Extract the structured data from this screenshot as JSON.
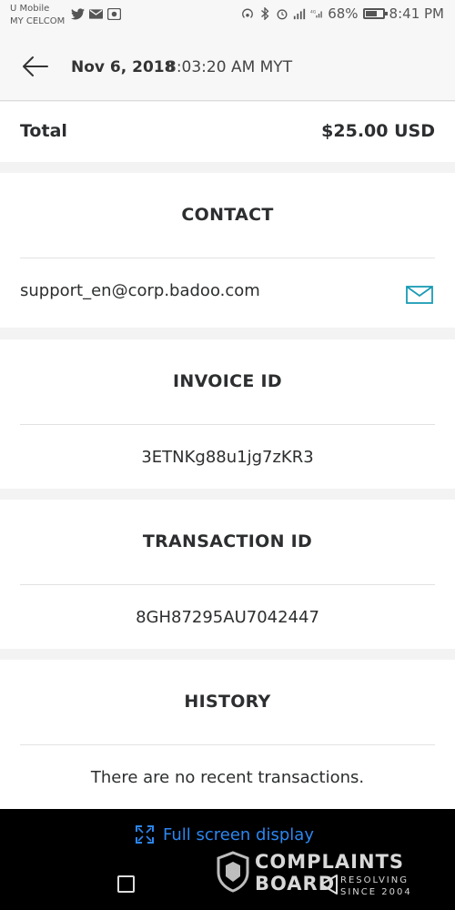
{
  "status_bar": {
    "carrier_line1": "U Mobile",
    "carrier_line2": "MY CELCOM",
    "left_icons": [
      "twitter-icon",
      "mail-icon",
      "image-icon"
    ],
    "right_icons": [
      "hotspot-icon",
      "bluetooth-icon",
      "alarm-icon",
      "signal-icon",
      "4g-icon"
    ],
    "battery_percent": "68%",
    "battery_level": 0.68,
    "time": "8:41 PM"
  },
  "header": {
    "date": "Nov 6, 2018",
    "time": "8:03:20 AM MYT"
  },
  "total": {
    "label": "Total",
    "value": "$25.00 USD"
  },
  "contact": {
    "title": "CONTACT",
    "email": "support_en@corp.badoo.com"
  },
  "invoice": {
    "title": "INVOICE ID",
    "value": "3ETNKg88u1jg7zKR3"
  },
  "transaction": {
    "title": "TRANSACTION ID",
    "value": "8GH87295AU7042447"
  },
  "history": {
    "title": "HISTORY",
    "empty_text": "There are no recent transactions."
  },
  "bottom_bar": {
    "fullscreen_label": "Full screen display"
  },
  "watermark": {
    "line1": "COMPLAINTS",
    "line2": "BOARD",
    "tag1": "RESOLVING",
    "tag2": "SINCE 2004"
  },
  "colors": {
    "accent_blue": "#2c86f0",
    "mail_icon_teal": "#1a9bb5"
  }
}
